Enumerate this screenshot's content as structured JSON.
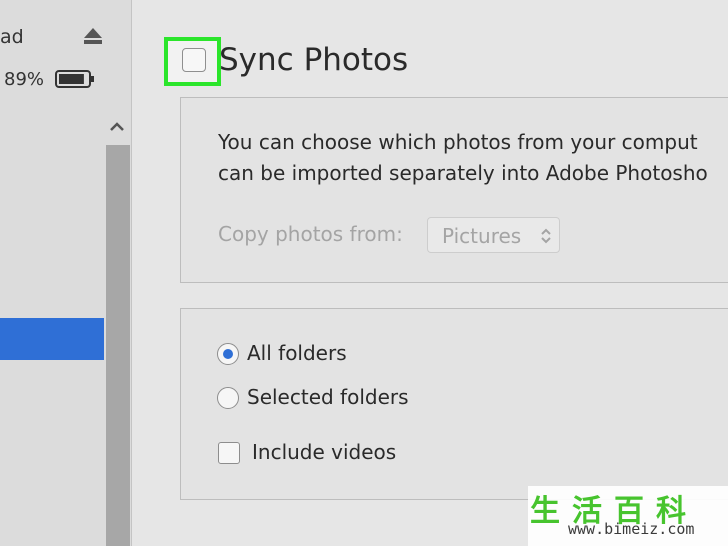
{
  "sidebar": {
    "device_name": "ad",
    "battery_percent": "89%",
    "battery_level": 0.89
  },
  "sync": {
    "title": "Sync Photos",
    "checked": false
  },
  "panel1": {
    "description_line1": "You can choose which photos from your comput",
    "description_line2": "can be imported separately into Adobe Photosho",
    "copy_label": "Copy photos from:",
    "source_value": "Pictures"
  },
  "options": {
    "all_folders": "All folders",
    "selected_folders": "Selected folders",
    "include_videos": "Include videos",
    "selected": "all_folders"
  },
  "watermark": {
    "logo": "生活百科",
    "url": "www.bimeiz.com"
  },
  "colors": {
    "accent": "#2f6fd6",
    "highlight": "#2be52b",
    "watermark_green": "#47c42e"
  }
}
